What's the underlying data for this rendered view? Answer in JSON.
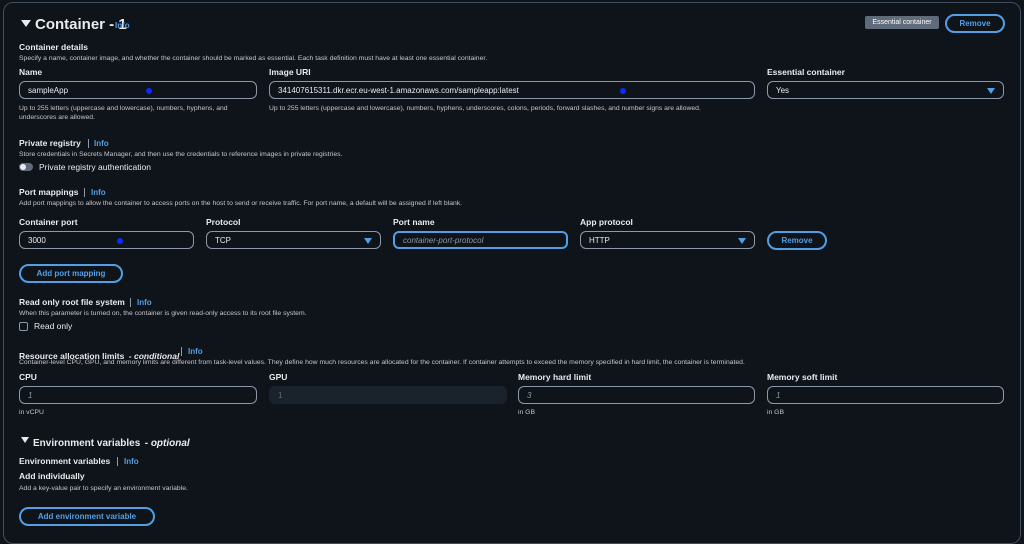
{
  "container": {
    "title": "Container - 1",
    "info": "Info",
    "essential_badge": "Essential container",
    "remove_label": "Remove"
  },
  "details": {
    "heading": "Container details",
    "description": "Specify a name, container image, and whether the container should be marked as essential. Each task definition must have at least one essential container.",
    "name_label": "Name",
    "name_value": "sampleApp",
    "name_hint_1": "Up to 255 letters (uppercase and lowercase), numbers, hyphens, and",
    "name_hint_2": "underscores are allowed.",
    "image_label": "Image URI",
    "image_value": "341407615311.dkr.ecr.eu-west-1.amazonaws.com/sampleapp:latest",
    "image_hint": "Up to 255 letters (uppercase and lowercase), numbers, hyphens, underscores, colons, periods, forward slashes, and number signs are allowed.",
    "essential_label": "Essential container",
    "essential_value": "Yes"
  },
  "private_registry": {
    "heading": "Private registry",
    "info": "Info",
    "description": "Store credentials in Secrets Manager, and then use the credentials to reference images in private registries.",
    "toggle_label": "Private registry authentication"
  },
  "port_mappings": {
    "heading": "Port mappings",
    "info": "Info",
    "description": "Add port mappings to allow the container to access ports on the host to send or receive traffic. For port name, a default will be assigned if left blank.",
    "container_port_label": "Container port",
    "container_port_value": "3000",
    "protocol_label": "Protocol",
    "protocol_value": "TCP",
    "port_name_label": "Port name",
    "port_name_placeholder": "container-port-protocol",
    "app_protocol_label": "App protocol",
    "app_protocol_value": "HTTP",
    "remove_label": "Remove",
    "add_label": "Add port mapping"
  },
  "read_only": {
    "heading": "Read only root file system",
    "info": "Info",
    "description": "When this parameter is turned on, the container is given read-only access to its root file system.",
    "checkbox_label": "Read only"
  },
  "resources": {
    "heading": "Resource allocation limits",
    "heading_suffix": "- conditional",
    "info": "Info",
    "description": "Container-level CPU, GPU, and memory limits are different from task-level values. They define how much resources are allocated for the container. If container attempts to exceed the memory specified in hard limit, the container is terminated.",
    "cpu_label": "CPU",
    "cpu_value": "1",
    "cpu_unit": "in vCPU",
    "gpu_label": "GPU",
    "gpu_value": "1",
    "mem_hard_label": "Memory hard limit",
    "mem_hard_value": "3",
    "mem_hard_unit": "in GB",
    "mem_soft_label": "Memory soft limit",
    "mem_soft_value": "1",
    "mem_soft_unit": "in GB"
  },
  "env": {
    "section_title": "Environment variables",
    "section_suffix": "- optional",
    "heading": "Environment variables",
    "info": "Info",
    "add_individually": "Add individually",
    "description": "Add a key-value pair to specify an environment variable.",
    "add_button": "Add environment variable"
  },
  "colors": {
    "background": "#0f141a",
    "accent": "#539fe5",
    "border": "#8d99a8",
    "marker": "#0a2bff"
  }
}
